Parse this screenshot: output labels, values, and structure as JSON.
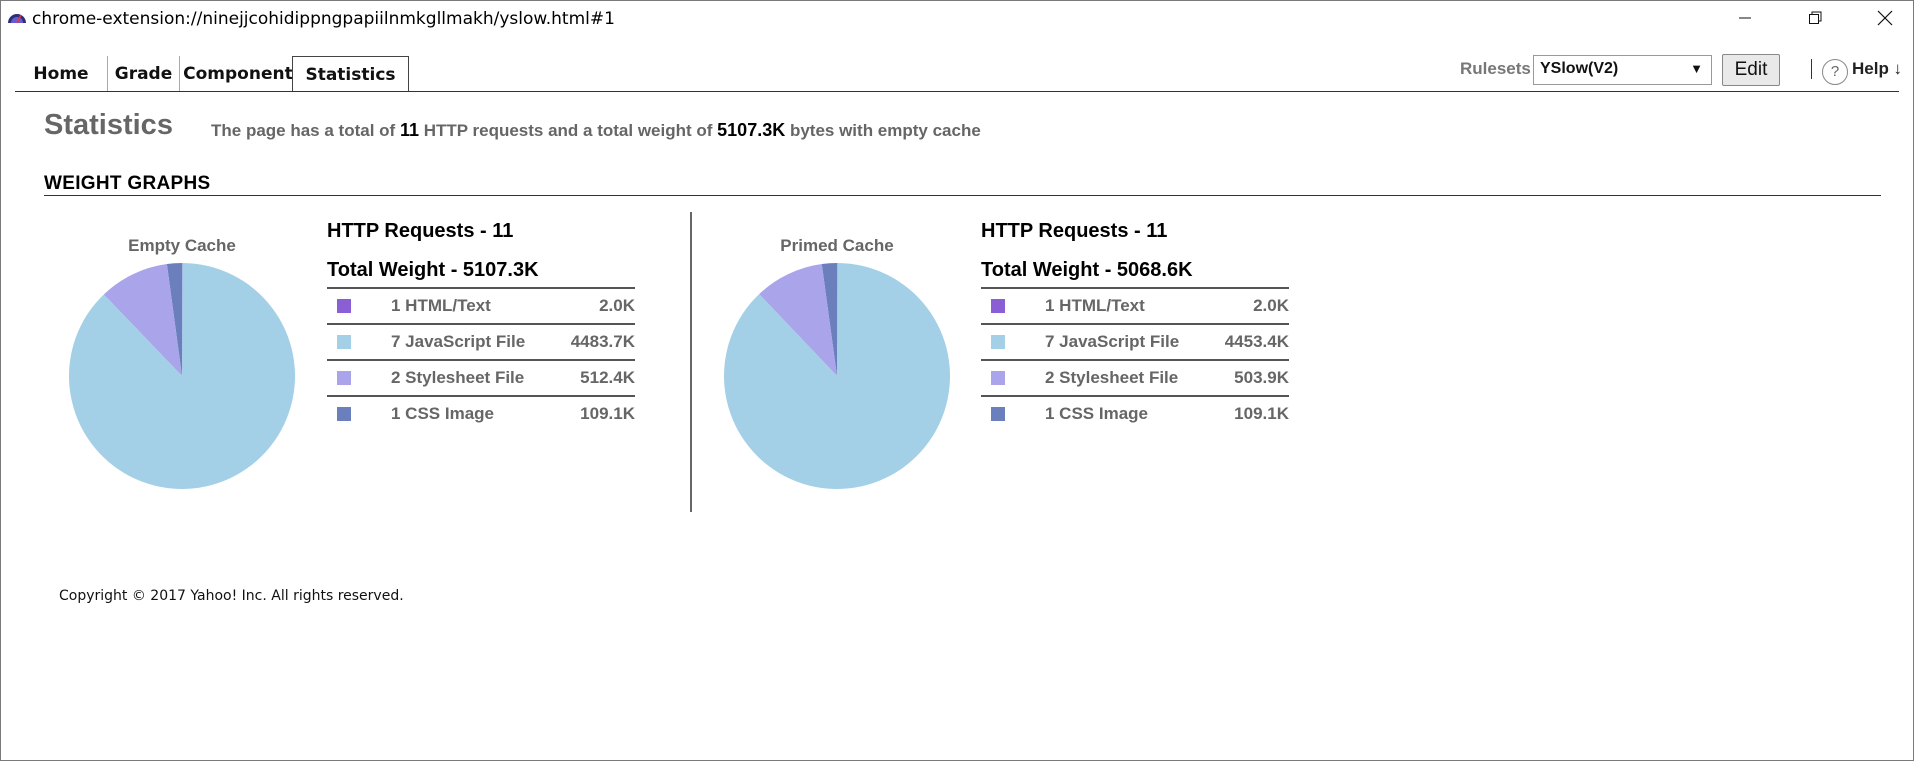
{
  "window": {
    "title": "chrome-extension://ninejjcohidippngpapiilnmkgllmakh/yslow.html#1",
    "controls": [
      "minimize-icon",
      "restore-icon",
      "close-icon"
    ]
  },
  "tabs": [
    {
      "label": "Home"
    },
    {
      "label": "Grade"
    },
    {
      "label": "Components"
    },
    {
      "label": "Statistics",
      "active": true
    }
  ],
  "toolbar": {
    "rulesets_label": "Rulesets",
    "ruleset_value": "YSlow(V2)",
    "edit_label": "Edit",
    "help_label": "Help ↓"
  },
  "stats": {
    "title": "Statistics",
    "summary_pre": "The page has a total of",
    "requests": "11",
    "summary_mid": "HTTP requests and a total weight of",
    "weight": "5107.3K",
    "summary_post": "bytes with empty cache"
  },
  "section_title": "WEIGHT GRAPHS",
  "colors": {
    "html": "#8a5fd6",
    "javascript": "#a3d0e6",
    "stylesheet": "#aaa4ea",
    "cssimage": "#6a7fbb"
  },
  "chart_data": [
    {
      "type": "pie",
      "title": "Empty Cache",
      "requests_heading": "HTTP Requests - 11",
      "weight_heading": "Total Weight - 5107.3K",
      "rows": [
        {
          "label": "1 HTML/Text",
          "size": "2.0K",
          "value": 2.0,
          "color": "#8a5fd6"
        },
        {
          "label": "7 JavaScript File",
          "size": "4483.7K",
          "value": 4483.7,
          "color": "#a3d0e6"
        },
        {
          "label": "2 Stylesheet File",
          "size": "512.4K",
          "value": 512.4,
          "color": "#aaa4ea"
        },
        {
          "label": "1 CSS Image",
          "size": "109.1K",
          "value": 109.1,
          "color": "#6a7fbb"
        }
      ]
    },
    {
      "type": "pie",
      "title": "Primed Cache",
      "requests_heading": "HTTP Requests - 11",
      "weight_heading": "Total Weight - 5068.6K",
      "rows": [
        {
          "label": "1 HTML/Text",
          "size": "2.0K",
          "value": 2.0,
          "color": "#8a5fd6"
        },
        {
          "label": "7 JavaScript File",
          "size": "4453.4K",
          "value": 4453.4,
          "color": "#a3d0e6"
        },
        {
          "label": "2 Stylesheet File",
          "size": "503.9K",
          "value": 503.9,
          "color": "#aaa4ea"
        },
        {
          "label": "1 CSS Image",
          "size": "109.1K",
          "value": 109.1,
          "color": "#6a7fbb"
        }
      ]
    }
  ],
  "footer": {
    "copyright": "Copyright © 2017 Yahoo! Inc. All rights reserved."
  }
}
